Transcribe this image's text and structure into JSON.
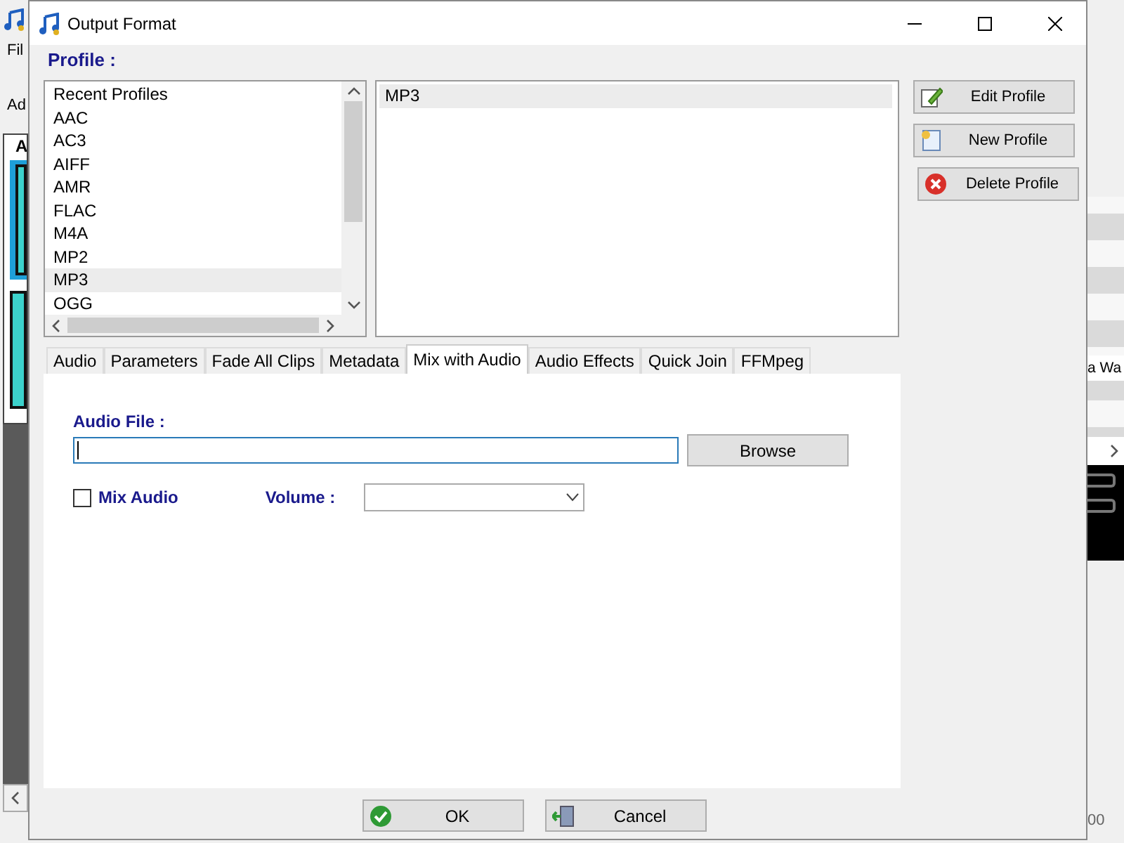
{
  "background_window": {
    "left_texts": [
      "Fil",
      "Ad",
      "A"
    ],
    "right_texts": [
      "a Wa",
      "00"
    ]
  },
  "window": {
    "title": "Output Format"
  },
  "profile_label": "Profile :",
  "profile_list": [
    {
      "label": "Recent Profiles",
      "selected": false
    },
    {
      "label": "AAC",
      "selected": false
    },
    {
      "label": "AC3",
      "selected": false
    },
    {
      "label": "AIFF",
      "selected": false
    },
    {
      "label": "AMR",
      "selected": false
    },
    {
      "label": "FLAC",
      "selected": false
    },
    {
      "label": "M4A",
      "selected": false
    },
    {
      "label": "MP2",
      "selected": false
    },
    {
      "label": "MP3",
      "selected": true
    },
    {
      "label": "OGG",
      "selected": false
    }
  ],
  "chosen_profiles": [
    {
      "label": "MP3",
      "selected": true
    }
  ],
  "profile_buttons": [
    {
      "kind": "edit",
      "label": "Edit Profile"
    },
    {
      "kind": "new",
      "label": "New Profile"
    },
    {
      "kind": "delete",
      "label": "Delete Profile"
    }
  ],
  "tabs": [
    {
      "label": "Audio",
      "selected": false
    },
    {
      "label": "Parameters",
      "selected": false
    },
    {
      "label": "Fade All Clips",
      "selected": false
    },
    {
      "label": "Metadata",
      "selected": false
    },
    {
      "label": "Mix with Audio",
      "selected": true
    },
    {
      "label": "Audio Effects",
      "selected": false
    },
    {
      "label": "Quick Join",
      "selected": false
    },
    {
      "label": "FFMpeg",
      "selected": false
    }
  ],
  "mix_panel": {
    "audio_file_label": "Audio File :",
    "browse_button": "Browse",
    "mix_audio": {
      "label": "Mix Audio",
      "checked": false
    },
    "volume_label": "Volume :"
  },
  "dialog_buttons": [
    {
      "kind": "ok",
      "label": "OK"
    },
    {
      "kind": "cancel",
      "label": "Cancel"
    }
  ]
}
